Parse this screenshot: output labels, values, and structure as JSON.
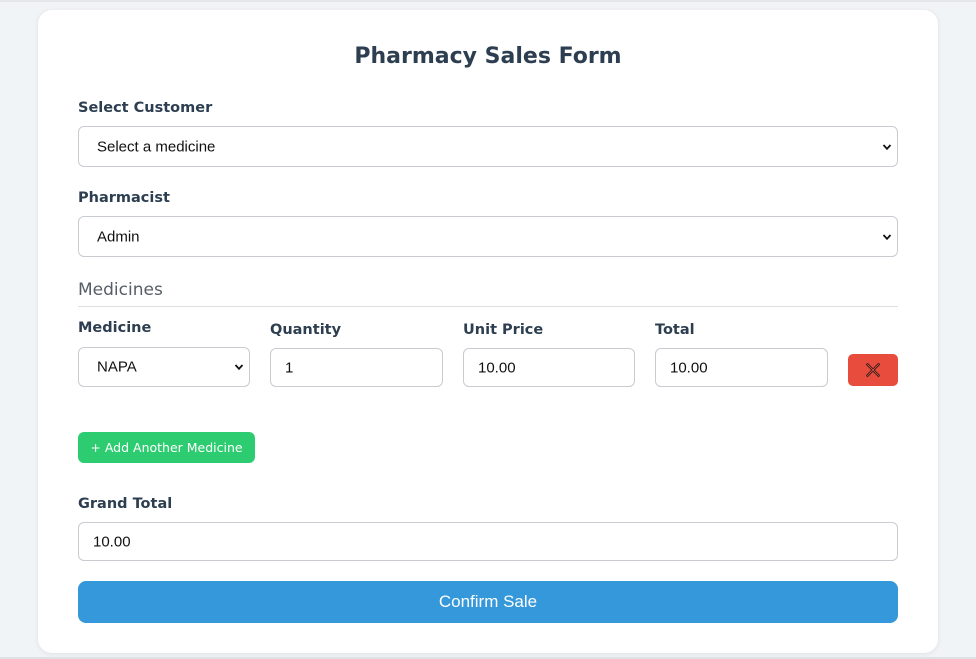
{
  "form": {
    "title": "Pharmacy Sales Form",
    "customer": {
      "label": "Select Customer",
      "selected": "Select a medicine"
    },
    "pharmacist": {
      "label": "Pharmacist",
      "selected": "Admin"
    },
    "medicines_section": {
      "heading": "Medicines",
      "columns": {
        "medicine": "Medicine",
        "quantity": "Quantity",
        "unit_price": "Unit Price",
        "total": "Total"
      },
      "rows": [
        {
          "medicine": "NAPA",
          "quantity": "1",
          "unit_price": "10.00",
          "total": "10.00",
          "remove_icon": "close-icon"
        }
      ],
      "add_label": "+ Add Another Medicine"
    },
    "grand_total": {
      "label": "Grand Total",
      "value": "10.00"
    },
    "confirm_label": "Confirm Sale"
  },
  "colors": {
    "page_bg": "#f1f4f7",
    "text": "#2c3e50",
    "remove": "#e74c3c",
    "add": "#2ecc71",
    "confirm": "#3498db"
  }
}
